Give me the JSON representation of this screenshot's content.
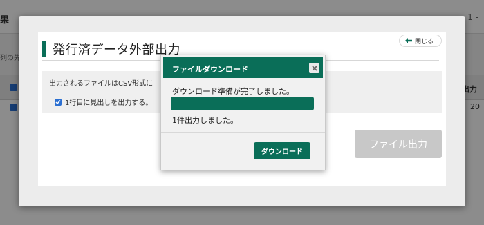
{
  "background": {
    "title": "果",
    "pagination": "1 -",
    "note": "列の先",
    "col_header": "出力",
    "col_value": "20"
  },
  "modal": {
    "back_label": "閉じる",
    "heading": "発行済データ外部出力",
    "info_text": "出力されるファイルはCSV形式に",
    "checkbox_label": "1行目に見出しを出力する。",
    "checkbox_checked": true,
    "export_button": "ファイル出力"
  },
  "dialog": {
    "title": "ファイルダウンロード",
    "status": "ダウンロード準備が完了しました。",
    "progress": 1.0,
    "result": "1件出力しました。",
    "download_button": "ダウンロード"
  },
  "colors": {
    "accent": "#0a6e58",
    "checkbox": "#2b6fd1",
    "disabled": "#c8c8c8"
  }
}
